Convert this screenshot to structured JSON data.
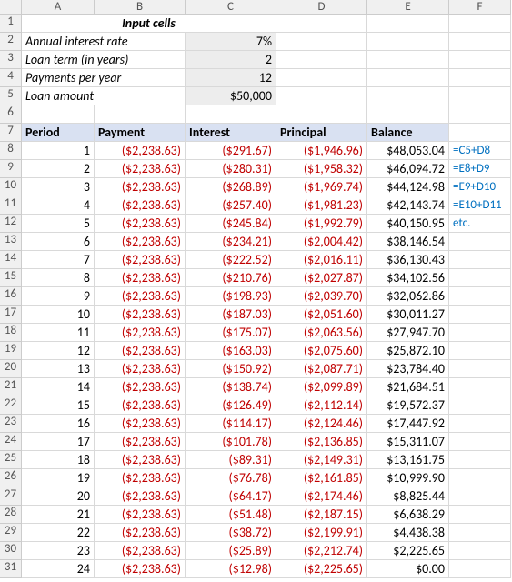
{
  "columns": [
    "A",
    "B",
    "C",
    "D",
    "E",
    "F"
  ],
  "row_numbers": [
    1,
    2,
    3,
    4,
    5,
    6,
    7,
    8,
    9,
    10,
    11,
    12,
    13,
    14,
    15,
    16,
    17,
    18,
    19,
    20,
    21,
    22,
    23,
    24,
    25,
    26,
    27,
    28,
    29,
    30,
    31
  ],
  "inputs": {
    "title": "Input cells",
    "labels": {
      "rate": "Annual interest rate",
      "term": "Loan term (in years)",
      "ppy": "Payments per year",
      "amount": "Loan amount"
    },
    "values": {
      "rate": "7%",
      "term": "2",
      "ppy": "12",
      "amount": "$50,000"
    }
  },
  "table_headers": {
    "period": "Period",
    "payment": "Payment",
    "interest": "Interest",
    "principal": "Principal",
    "balance": "Balance"
  },
  "annotations": {
    "r8": "=C5+D8",
    "r9": "=E8+D9",
    "r10": "=E9+D10",
    "r11": "=E10+D11",
    "r12": "etc."
  },
  "chart_data": {
    "type": "table",
    "columns": [
      "Period",
      "Payment",
      "Interest",
      "Principal",
      "Balance"
    ],
    "rows": [
      {
        "period": "1",
        "payment": "($2,238.63)",
        "interest": "($291.67)",
        "principal": "($1,946.96)",
        "balance": "$48,053.04"
      },
      {
        "period": "2",
        "payment": "($2,238.63)",
        "interest": "($280.31)",
        "principal": "($1,958.32)",
        "balance": "$46,094.72"
      },
      {
        "period": "3",
        "payment": "($2,238.63)",
        "interest": "($268.89)",
        "principal": "($1,969.74)",
        "balance": "$44,124.98"
      },
      {
        "period": "4",
        "payment": "($2,238.63)",
        "interest": "($257.40)",
        "principal": "($1,981.23)",
        "balance": "$42,143.74"
      },
      {
        "period": "5",
        "payment": "($2,238.63)",
        "interest": "($245.84)",
        "principal": "($1,992.79)",
        "balance": "$40,150.95"
      },
      {
        "period": "6",
        "payment": "($2,238.63)",
        "interest": "($234.21)",
        "principal": "($2,004.42)",
        "balance": "$38,146.54"
      },
      {
        "period": "7",
        "payment": "($2,238.63)",
        "interest": "($222.52)",
        "principal": "($2,016.11)",
        "balance": "$36,130.43"
      },
      {
        "period": "8",
        "payment": "($2,238.63)",
        "interest": "($210.76)",
        "principal": "($2,027.87)",
        "balance": "$34,102.56"
      },
      {
        "period": "9",
        "payment": "($2,238.63)",
        "interest": "($198.93)",
        "principal": "($2,039.70)",
        "balance": "$32,062.86"
      },
      {
        "period": "10",
        "payment": "($2,238.63)",
        "interest": "($187.03)",
        "principal": "($2,051.60)",
        "balance": "$30,011.27"
      },
      {
        "period": "11",
        "payment": "($2,238.63)",
        "interest": "($175.07)",
        "principal": "($2,063.56)",
        "balance": "$27,947.70"
      },
      {
        "period": "12",
        "payment": "($2,238.63)",
        "interest": "($163.03)",
        "principal": "($2,075.60)",
        "balance": "$25,872.10"
      },
      {
        "period": "13",
        "payment": "($2,238.63)",
        "interest": "($150.92)",
        "principal": "($2,087.71)",
        "balance": "$23,784.40"
      },
      {
        "period": "14",
        "payment": "($2,238.63)",
        "interest": "($138.74)",
        "principal": "($2,099.89)",
        "balance": "$21,684.51"
      },
      {
        "period": "15",
        "payment": "($2,238.63)",
        "interest": "($126.49)",
        "principal": "($2,112.14)",
        "balance": "$19,572.37"
      },
      {
        "period": "16",
        "payment": "($2,238.63)",
        "interest": "($114.17)",
        "principal": "($2,124.46)",
        "balance": "$17,447.92"
      },
      {
        "period": "17",
        "payment": "($2,238.63)",
        "interest": "($101.78)",
        "principal": "($2,136.85)",
        "balance": "$15,311.07"
      },
      {
        "period": "18",
        "payment": "($2,238.63)",
        "interest": "($89.31)",
        "principal": "($2,149.31)",
        "balance": "$13,161.75"
      },
      {
        "period": "19",
        "payment": "($2,238.63)",
        "interest": "($76.78)",
        "principal": "($2,161.85)",
        "balance": "$10,999.90"
      },
      {
        "period": "20",
        "payment": "($2,238.63)",
        "interest": "($64.17)",
        "principal": "($2,174.46)",
        "balance": "$8,825.44"
      },
      {
        "period": "21",
        "payment": "($2,238.63)",
        "interest": "($51.48)",
        "principal": "($2,187.15)",
        "balance": "$6,638.29"
      },
      {
        "period": "22",
        "payment": "($2,238.63)",
        "interest": "($38.72)",
        "principal": "($2,199.91)",
        "balance": "$4,438.38"
      },
      {
        "period": "23",
        "payment": "($2,238.63)",
        "interest": "($25.89)",
        "principal": "($2,212.74)",
        "balance": "$2,225.65"
      },
      {
        "period": "24",
        "payment": "($2,238.63)",
        "interest": "($12.98)",
        "principal": "($2,225.65)",
        "balance": "$0.00"
      }
    ]
  }
}
